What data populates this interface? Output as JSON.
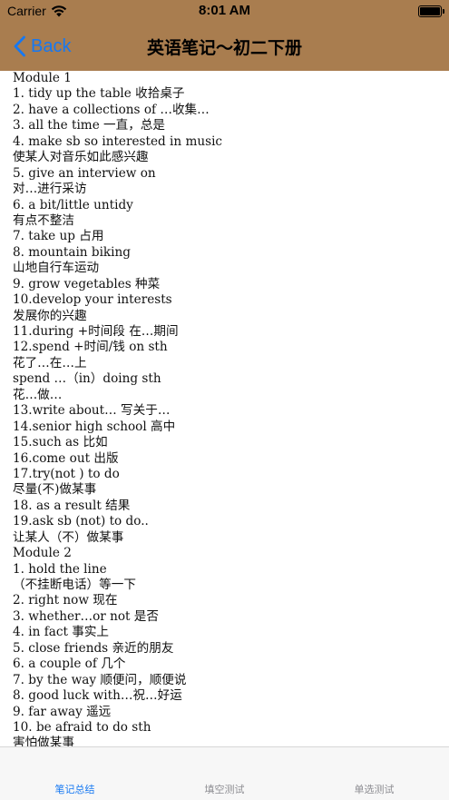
{
  "status_bar": {
    "carrier": "Carrier",
    "time": "8:01 AM"
  },
  "nav": {
    "back_label": "Back",
    "title": "英语笔记～初二下册"
  },
  "colors": {
    "header_bg": "#a97d4f",
    "accent": "#1678f2",
    "tab_inactive": "#8e8e93"
  },
  "icons": {
    "wifi": "wifi-icon",
    "battery": "battery-icon",
    "back": "chevron-left-icon"
  },
  "content": {
    "lines": [
      "Module  1",
      "1.    tidy up the table 收拾桌子",
      "2.    have a collections of …收集…",
      "3.    all the time 一直，总是",
      "4.    make sb so interested in music",
      "使某人对音乐如此感兴趣",
      "5.    give an interview on",
      "对…进行采访",
      "6.    a bit/little untidy",
      "有点不整洁",
      "7.    take up 占用",
      "8.    mountain biking",
      "山地自行车运动",
      "9.    grow vegetables 种菜",
      "10.develop your interests",
      "发展你的兴趣",
      "11.during +时间段 在…期间",
      "12.spend +时间/钱 on sth",
      "花了…在…上",
      "spend …（in）doing sth",
      "花…做…",
      "13.write about… 写关于…",
      "14.senior high school 高中",
      "15.such as 比如",
      "16.come out 出版",
      "17.try(not ) to do",
      "尽量(不)做某事",
      "18. as a result 结果",
      "19.ask sb (not) to do..",
      "让某人（不）做某事",
      "              Module  2",
      "1.    hold the line",
      "（不挂断电话）等一下",
      "2.    right now 现在",
      "3.    whether…or not 是否",
      "4.    in fact 事实上",
      "5.    close friends 亲近的朋友",
      "6.    a couple of 几个",
      "7.    by the way 顺便问，顺便说",
      "8.    good luck with…祝…好运",
      "9.    far away 遥远",
      "10. be afraid to do sth",
      "害怕做某事"
    ]
  },
  "tabs": [
    {
      "label": "笔记总结",
      "active": true
    },
    {
      "label": "填空测试",
      "active": false
    },
    {
      "label": "单选测试",
      "active": false
    }
  ]
}
